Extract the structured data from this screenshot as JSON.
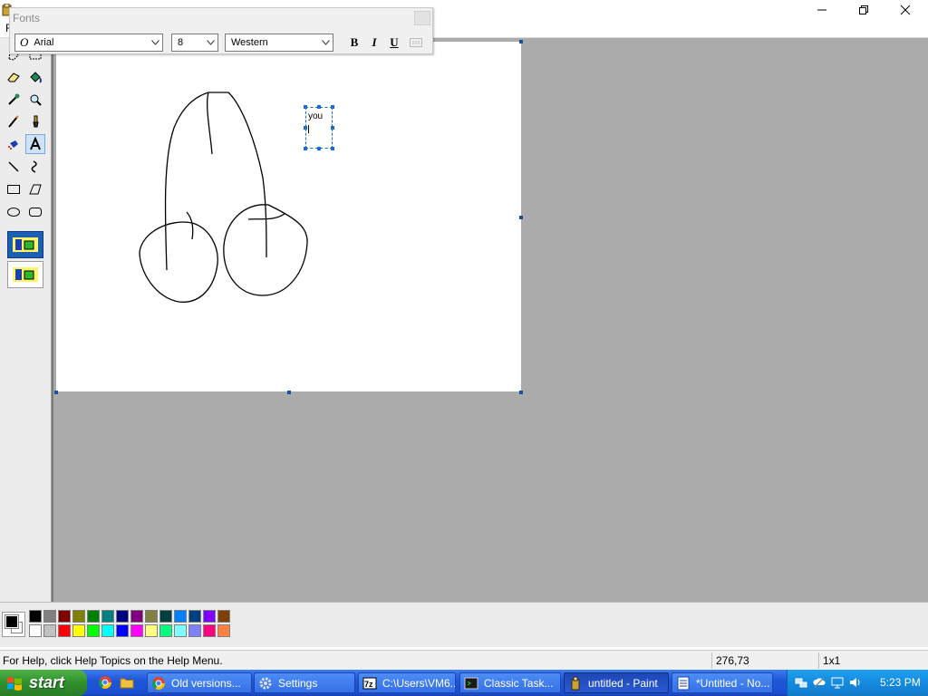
{
  "window": {
    "menu_fragment": "F",
    "controls": [
      "minimize-icon",
      "restore-icon",
      "close-icon"
    ]
  },
  "fonts_toolbar": {
    "title": "Fonts",
    "font_name": "Arial",
    "font_size": "8",
    "script": "Western",
    "bold_label": "B",
    "italic_label": "I",
    "underline_label": "U"
  },
  "canvas": {
    "text_box_content": "you"
  },
  "toolbox": {
    "tools": [
      "free-form-select-icon",
      "select-icon",
      "eraser-icon",
      "fill-icon",
      "pick-color-icon",
      "magnifier-icon",
      "pencil-icon",
      "brush-icon",
      "airbrush-icon",
      "text-icon",
      "line-icon",
      "curve-icon",
      "rectangle-icon",
      "polygon-icon",
      "ellipse-icon",
      "rounded-rectangle-icon"
    ],
    "active_tool": "text-icon"
  },
  "palette": {
    "foreground": "#000000",
    "background": "#ffffff",
    "top_row": [
      "#000000",
      "#808080",
      "#800000",
      "#808000",
      "#008000",
      "#008080",
      "#000080",
      "#800080",
      "#808040",
      "#004040",
      "#0080ff",
      "#004080",
      "#8000ff",
      "#804000"
    ],
    "bottom_row": [
      "#ffffff",
      "#c0c0c0",
      "#ff0000",
      "#ffff00",
      "#00ff00",
      "#00ffff",
      "#0000ff",
      "#ff00ff",
      "#ffff80",
      "#00ff80",
      "#80ffff",
      "#8080ff",
      "#ff0080",
      "#ff8040"
    ]
  },
  "status": {
    "help": "For Help, click Help Topics on the Help Menu.",
    "coords": "276,73",
    "size": "1x1"
  },
  "taskbar": {
    "start": "start",
    "tasks": [
      {
        "label": "Old versions...",
        "icon": "chrome-icon"
      },
      {
        "label": "Settings",
        "icon": "gear-icon"
      },
      {
        "label": "C:\\Users\\VM6...",
        "icon": "7zip-icon"
      },
      {
        "label": "Classic Task...",
        "icon": "terminal-icon"
      },
      {
        "label": "untitled - Paint",
        "icon": "paint-icon"
      },
      {
        "label": "*Untitled - No...",
        "icon": "notepad-icon"
      }
    ],
    "active_task": "untitled - Paint",
    "clock": "5:23 PM"
  }
}
